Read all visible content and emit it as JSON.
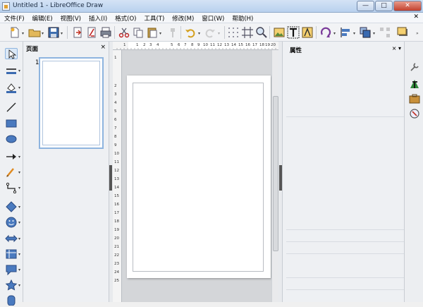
{
  "window": {
    "title": "Untitled 1 - LibreOffice Draw",
    "btn_min": "—",
    "btn_max": "□",
    "btn_close": "✕"
  },
  "menu": {
    "items": [
      "文件(F)",
      "编辑(E)",
      "视图(V)",
      "插入(I)",
      "格式(O)",
      "工具(T)",
      "修改(M)",
      "窗口(W)",
      "帮助(H)"
    ],
    "close_doc": "✕"
  },
  "pages_panel": {
    "title": "页面",
    "close": "×",
    "page_number": "1"
  },
  "properties_panel": {
    "title": "属性",
    "close": "×",
    "menu": "▾"
  },
  "hruler": {
    "labels": [
      "1",
      "1",
      "2",
      "3",
      "4",
      "5",
      "6",
      "7",
      "8",
      "9",
      "10",
      "11",
      "12",
      "13",
      "14",
      "15",
      "16",
      "17",
      "18",
      "19",
      "20"
    ]
  },
  "vruler": {
    "labels": [
      "1",
      "2",
      "3",
      "4",
      "5",
      "6",
      "7",
      "8",
      "9",
      "10",
      "11",
      "12",
      "13",
      "14",
      "15",
      "16",
      "17",
      "18",
      "19",
      "20",
      "21",
      "22",
      "23",
      "24",
      "25"
    ]
  },
  "colors": {
    "accent": "#8eb4df",
    "title_bar": "#c8daf0",
    "close_button": "#c2412e"
  }
}
